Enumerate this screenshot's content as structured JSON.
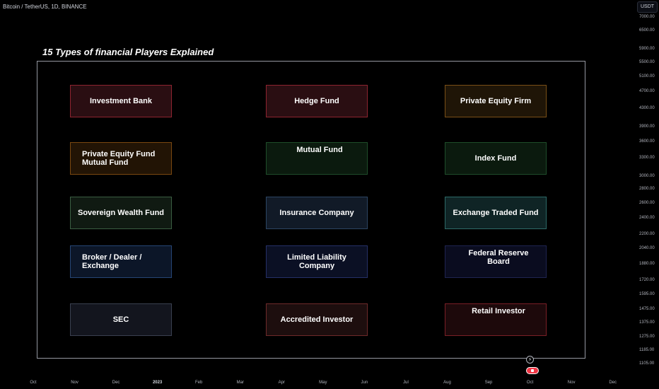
{
  "symbol_header": "Bitcoin / TetherUS, 1D, BINANCE",
  "currency_badge": "USDT",
  "colors": {
    "background": "#000000",
    "frame": "#9598a1",
    "axis_text": "#b2b5be",
    "marker_red": "#f23645"
  },
  "chart_data": {
    "type": "table",
    "title": "15 Types of financial Players Explained",
    "price_axis": {
      "scale": "log",
      "ticks": [
        7000,
        6500,
        5900,
        5500,
        5100,
        4700,
        4300,
        3900,
        3600,
        3300,
        3000,
        2800,
        2600,
        2400,
        2200,
        2040,
        1880,
        1720,
        1595,
        1475,
        1375,
        1275,
        1185,
        1105
      ],
      "tick_labels": [
        "7000.00",
        "6500.00",
        "5900.00",
        "5500.00",
        "5100.00",
        "4700.00",
        "4300.00",
        "3900.00",
        "3600.00",
        "3300.00",
        "3000.00",
        "2800.00",
        "2600.00",
        "2400.00",
        "2200.00",
        "2040.00",
        "1880.00",
        "1720.00",
        "1595.00",
        "1475.00",
        "1375.00",
        "1275.00",
        "1185.00",
        "1105.00"
      ],
      "range": [
        1060,
        7150
      ]
    },
    "time_axis": {
      "tick_labels": [
        "Oct",
        "Nov",
        "Dec",
        "2023",
        "Feb",
        "Mar",
        "Apr",
        "May",
        "Jun",
        "Jul",
        "Aug",
        "Sep",
        "Oct",
        "Nov",
        "Dec"
      ],
      "emphasized": [
        "2023"
      ]
    },
    "players": [
      {
        "label": "Investment Bank",
        "row": 1,
        "col": 1,
        "fill": "#2a0e12",
        "border": "#8e2430",
        "align": "center"
      },
      {
        "label": "Hedge Fund",
        "row": 1,
        "col": 2,
        "fill": "#2a0e12",
        "border": "#8e2430",
        "align": "center"
      },
      {
        "label": "Private Equity Firm",
        "row": 1,
        "col": 3,
        "fill": "#1f1507",
        "border": "#7a4f16",
        "align": "center"
      },
      {
        "label": "Private Equity Fund\nMutual Fund",
        "row": 2,
        "col": 1,
        "fill": "#221405",
        "border": "#7a4810",
        "align": "left"
      },
      {
        "label": "Mutual Fund",
        "row": 2,
        "col": 2,
        "fill": "#0b1a0e",
        "border": "#1f4d2a",
        "align": "top"
      },
      {
        "label": "Index Fund",
        "row": 2,
        "col": 3,
        "fill": "#0b1a0e",
        "border": "#1f4d2a",
        "align": "center"
      },
      {
        "label": "Sovereign Wealth Fund",
        "row": 3,
        "col": 1,
        "fill": "#101a12",
        "border": "#3b5e42",
        "align": "center"
      },
      {
        "label": "Insurance Company",
        "row": 3,
        "col": 2,
        "fill": "#111a27",
        "border": "#2c4563",
        "align": "center"
      },
      {
        "label": "Exchange Traded Fund",
        "row": 3,
        "col": 3,
        "fill": "#0f2425",
        "border": "#2d6a68",
        "align": "center"
      },
      {
        "label": "Broker / Dealer /\nExchange",
        "row": 4,
        "col": 1,
        "fill": "#0c1628",
        "border": "#264575",
        "align": "left"
      },
      {
        "label": "Limited Liability Company",
        "row": 4,
        "col": 2,
        "fill": "#0b1024",
        "border": "#253067",
        "align": "center"
      },
      {
        "label": "Federal Reserve Board",
        "row": 4,
        "col": 3,
        "fill": "#0a0c1f",
        "border": "#1f2450",
        "align": "top"
      },
      {
        "label": "SEC",
        "row": 5,
        "col": 1,
        "fill": "#13151e",
        "border": "#3a4050",
        "align": "center"
      },
      {
        "label": "Accredited Investor",
        "row": 5,
        "col": 2,
        "fill": "#1d0e0e",
        "border": "#6e2a2a",
        "align": "center"
      },
      {
        "label": "Retail Investor",
        "row": 5,
        "col": 3,
        "fill": "#1d090b",
        "border": "#7a1f26",
        "align": "top"
      }
    ]
  }
}
